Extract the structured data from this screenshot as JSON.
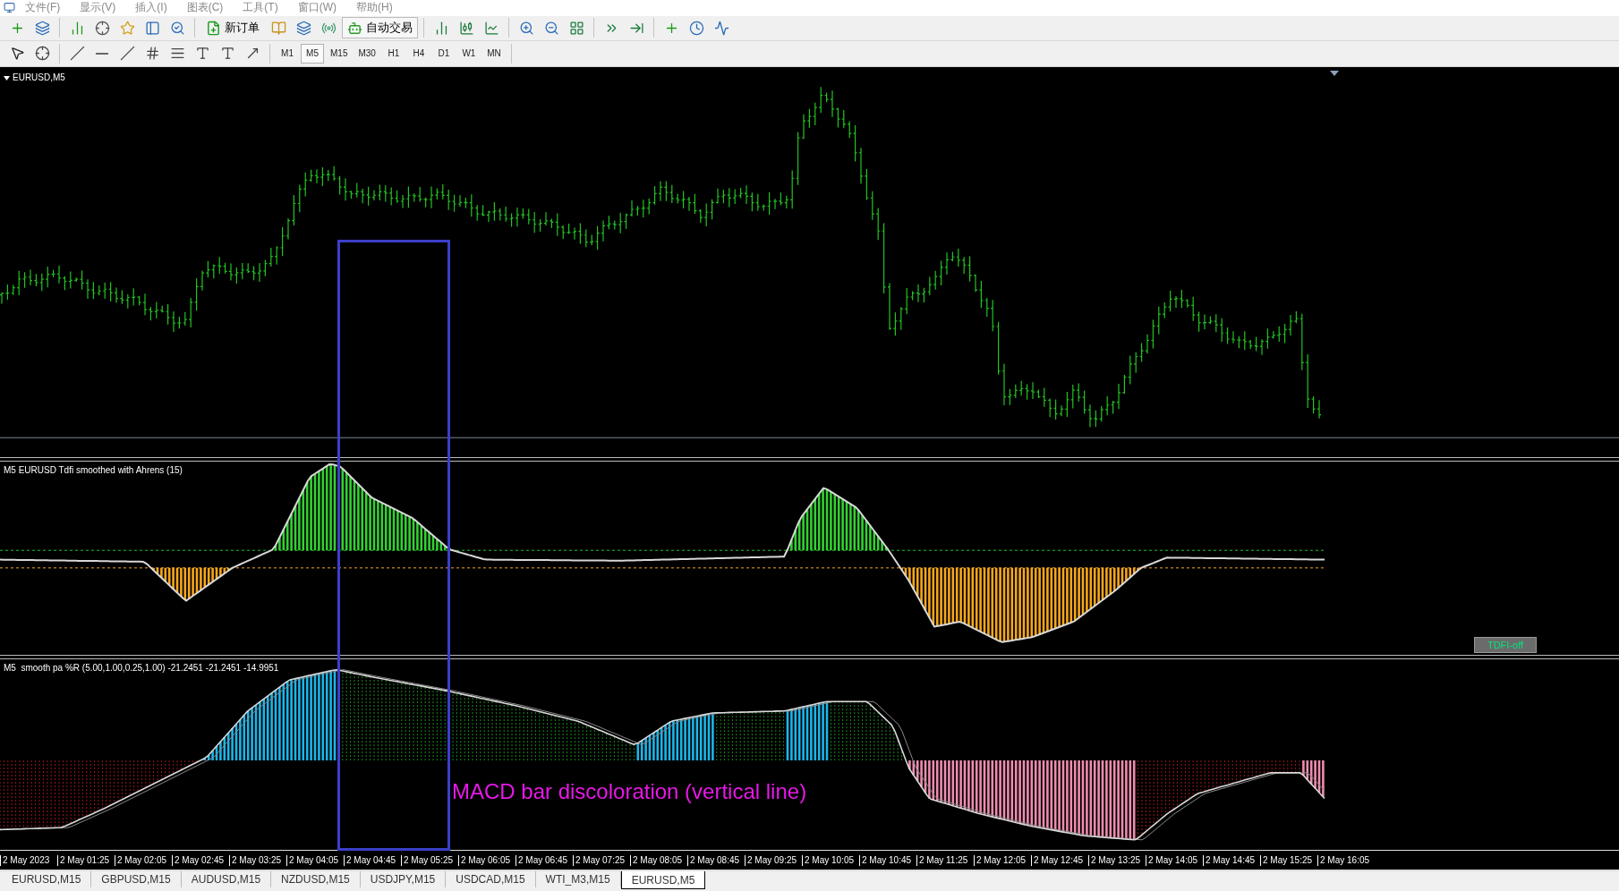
{
  "menu": [
    {
      "label": "文件(F)"
    },
    {
      "label": "显示(V)"
    },
    {
      "label": "插入(I)"
    },
    {
      "label": "图表(C)"
    },
    {
      "label": "工具(T)"
    },
    {
      "label": "窗口(W)"
    },
    {
      "label": "帮助(H)"
    }
  ],
  "toolbar": {
    "new_order": "新订单",
    "auto_trading": "自动交易"
  },
  "timeframes": [
    {
      "label": "M1",
      "selected": false
    },
    {
      "label": "M5",
      "selected": true
    },
    {
      "label": "M15",
      "selected": false
    },
    {
      "label": "M30",
      "selected": false
    },
    {
      "label": "H1",
      "selected": false
    },
    {
      "label": "H4",
      "selected": false
    },
    {
      "label": "D1",
      "selected": false
    },
    {
      "label": "W1",
      "selected": false
    },
    {
      "label": "MN",
      "selected": false
    }
  ],
  "chart": {
    "title": "EURUSD,M5"
  },
  "indicators": [
    {
      "title": "M5 EURUSD Tdfi smoothed with Ahrens (15)",
      "button": "TDFI-off"
    },
    {
      "title": "M5  smooth pa %R (5.00,1.00,0.25,1.00) -21.2451 -21.2451 -14.9951"
    }
  ],
  "annotation": "MACD bar discoloration (vertical line)",
  "time_axis": [
    "2 May 2023",
    "2 May 01:25",
    "2 May 02:05",
    "2 May 02:45",
    "2 May 03:25",
    "2 May 04:05",
    "2 May 04:45",
    "2 May 05:25",
    "2 May 06:05",
    "2 May 06:45",
    "2 May 07:25",
    "2 May 08:05",
    "2 May 08:45",
    "2 May 09:25",
    "2 May 10:05",
    "2 May 10:45",
    "2 May 11:25",
    "2 May 12:05",
    "2 May 12:45",
    "2 May 13:25",
    "2 May 14:05",
    "2 May 14:45",
    "2 May 15:25",
    "2 May 16:05"
  ],
  "tabs": [
    {
      "label": "EURUSD,M15",
      "selected": false
    },
    {
      "label": "GBPUSD,M15",
      "selected": false
    },
    {
      "label": "AUDUSD,M15",
      "selected": false
    },
    {
      "label": "NZDUSD,M15",
      "selected": false
    },
    {
      "label": "USDJPY,M15",
      "selected": false
    },
    {
      "label": "USDCAD,M15",
      "selected": false
    },
    {
      "label": "WTI_M3,M15",
      "selected": false
    },
    {
      "label": "EURUSD,M5",
      "selected": true
    }
  ]
}
